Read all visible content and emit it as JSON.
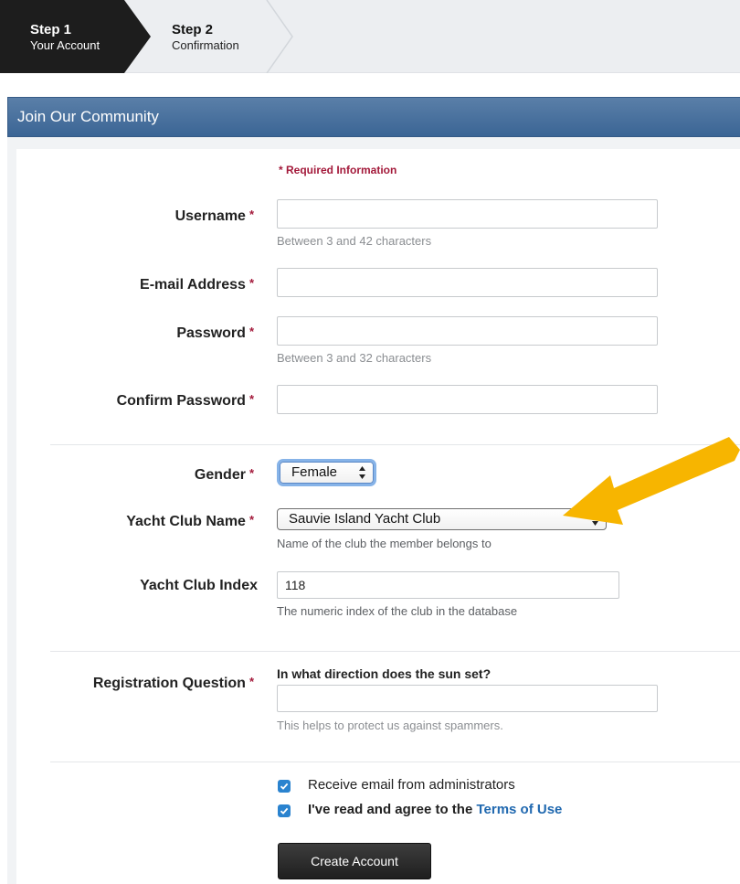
{
  "steps": [
    {
      "title": "Step 1",
      "subtitle": "Your Account",
      "active": true
    },
    {
      "title": "Step 2",
      "subtitle": "Confirmation",
      "active": false
    }
  ],
  "panel": {
    "title": "Join Our Community"
  },
  "form": {
    "required_info": "* Required Information",
    "required_mark": "*",
    "username": {
      "label": "Username",
      "value": "",
      "hint": "Between 3 and 42 characters"
    },
    "email": {
      "label": "E-mail Address",
      "value": ""
    },
    "password": {
      "label": "Password",
      "value": "",
      "hint": "Between 3 and 32 characters"
    },
    "confirm_password": {
      "label": "Confirm Password",
      "value": ""
    },
    "gender": {
      "label": "Gender",
      "selected": "Female"
    },
    "yacht_club_name": {
      "label": "Yacht Club Name",
      "selected": "Sauvie Island Yacht Club",
      "hint": "Name of the club the member belongs to"
    },
    "yacht_club_index": {
      "label": "Yacht Club Index",
      "value": "118",
      "hint": "The numeric index of the club in the database"
    },
    "registration_question": {
      "label": "Registration Question",
      "question": "In what direction does the sun set?",
      "value": "",
      "hint": "This helps to protect us against spammers."
    },
    "receive_email": {
      "label": "Receive email from administrators",
      "checked": true
    },
    "terms": {
      "label_prefix": "I've read and agree to the ",
      "link_text": "Terms of Use",
      "checked": true
    },
    "submit_label": "Create Account"
  },
  "colors": {
    "header_blue": "#3b6595",
    "required_red": "#a3193a",
    "link_blue": "#2169b0",
    "checkbox_blue": "#2a83cf",
    "annotation_arrow": "#f7b500"
  },
  "icons": {
    "select_arrows": "updown-arrows-icon",
    "checkmark": "checkmark-icon",
    "annotation": "arrow-pointer-icon"
  }
}
